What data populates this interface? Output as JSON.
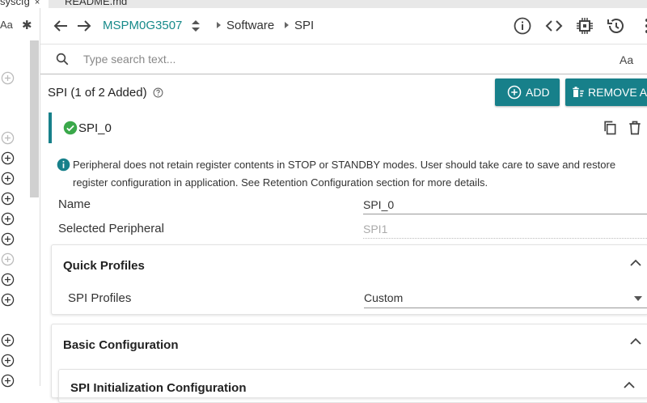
{
  "tabs": [
    {
      "label": "syscfg",
      "close": "×"
    },
    {
      "label": "README.md"
    }
  ],
  "left_toolbar": {
    "case_label": "Aa",
    "regex_label": "✱"
  },
  "header": {
    "device": "MSPM0G3507",
    "breadcrumb": [
      "Software",
      "SPI"
    ],
    "icons": [
      "arrow-left-icon",
      "arrow-right-icon",
      "updown-icon",
      "info-icon",
      "code-icon",
      "chip-icon",
      "history-icon",
      "more-icon"
    ]
  },
  "search": {
    "placeholder": "Type search text...",
    "case_label": "Aa"
  },
  "module": {
    "title": "SPI (1 of 2 Added)",
    "add_label": "ADD",
    "remove_label": "REMOVE ALL",
    "instance_name": "SPI_0",
    "info_line1": "Peripheral does not retain register contents in STOP or STANDBY modes. User should take care to save and restore",
    "info_line2": "register configuration in application. See Retention Configuration section for more details.",
    "fields": [
      {
        "label": "Name",
        "value": "SPI_0"
      },
      {
        "label": "Selected Peripheral",
        "value": "SPI1"
      }
    ]
  },
  "quick_profiles": {
    "title": "Quick Profiles",
    "row_label": "SPI Profiles",
    "row_value": "Custom"
  },
  "basic_config": {
    "title": "Basic Configuration",
    "sub_title": "SPI Initialization Configuration"
  },
  "colors": {
    "accent": "#17808a",
    "device": "#178a8a",
    "success": "#3aa84a"
  }
}
